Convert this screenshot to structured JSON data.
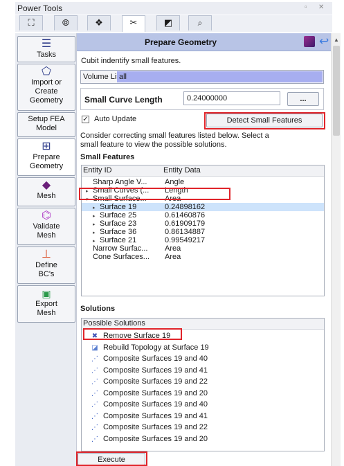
{
  "window": {
    "title": "Power Tools",
    "ctrl_float": "▫",
    "ctrl_close": "✕"
  },
  "top_tabs": [
    {
      "icon": "mesh-tool-icon",
      "glyph": "⛶"
    },
    {
      "icon": "geometry-tool-icon",
      "glyph": "⦾"
    },
    {
      "icon": "cluster-tool-icon",
      "glyph": "❖"
    },
    {
      "icon": "prepare-geometry-tab-icon",
      "glyph": "✂"
    },
    {
      "icon": "image-tab-icon",
      "glyph": "◩"
    },
    {
      "icon": "search-icon",
      "glyph": "🔍"
    }
  ],
  "sidebar": {
    "items": [
      {
        "label": "Tasks",
        "icon": "list-icon",
        "glyph": "☰"
      },
      {
        "label": "Import or Create Geometry",
        "icon": "geometry-import-icon",
        "glyph": "⬠"
      },
      {
        "label": "Setup FEA Model",
        "icon": "",
        "glyph": ""
      },
      {
        "label": "Prepare Geometry",
        "icon": "prepare-geometry-icon",
        "glyph": "⊞"
      },
      {
        "label": "Mesh",
        "icon": "mesh-cube-icon",
        "glyph": "◆"
      },
      {
        "label": "Validate Mesh",
        "icon": "validate-mesh-icon",
        "glyph": "⌬"
      },
      {
        "label": "Define BC's",
        "icon": "define-bc-icon",
        "glyph": "⊥"
      },
      {
        "label": "Export Mesh",
        "icon": "save-icon",
        "glyph": "💾"
      }
    ]
  },
  "panel": {
    "title": "Prepare Geometry",
    "intro_text": "Cubit indentify small features.",
    "volume_list_label": "Volume List",
    "volume_list_value": "all",
    "small_curve_label": "Small Curve Length",
    "small_curve_value": "0.24000000",
    "browse_label": "...",
    "auto_update_label": "Auto Update",
    "auto_update_checked": true,
    "check_glyph": "✓",
    "detect_button_label": "Detect Small Features",
    "instruction_text_1": "Consider correcting small features listed below. Select a",
    "instruction_text_2": "small feature to view the possible solutions.",
    "small_features_heading": "Small Features",
    "tree_headers": {
      "entity_id": "Entity ID",
      "entity_data": "Entity Data"
    },
    "tree_rows": [
      {
        "id": "Sharp Angle V...",
        "data": "Angle",
        "arrow": "",
        "indent": 1,
        "selected": false
      },
      {
        "id": "Small Curves (...",
        "data": "Length",
        "arrow": "▸",
        "indent": 1,
        "selected": false
      },
      {
        "id": "Small Surface...",
        "data": "Area",
        "arrow": "▾",
        "indent": 1,
        "selected": false
      },
      {
        "id": "Surface 19",
        "data": "0.24898162",
        "arrow": "▸",
        "indent": 2,
        "selected": true
      },
      {
        "id": "Surface 25",
        "data": "0.61460876",
        "arrow": "▸",
        "indent": 2,
        "selected": false
      },
      {
        "id": "Surface 23",
        "data": "0.61909179",
        "arrow": "▸",
        "indent": 2,
        "selected": false
      },
      {
        "id": "Surface 36",
        "data": "0.86134887",
        "arrow": "▸",
        "indent": 2,
        "selected": false
      },
      {
        "id": "Surface 21",
        "data": "0.99549217",
        "arrow": "▸",
        "indent": 2,
        "selected": false
      },
      {
        "id": "Narrow Surfac...",
        "data": "Area",
        "arrow": "",
        "indent": 1,
        "selected": false
      },
      {
        "id": "Cone Surfaces...",
        "data": "Area",
        "arrow": "",
        "indent": 1,
        "selected": false
      }
    ],
    "solutions_heading": "Solutions",
    "possible_solutions_header": "Possible Solutions",
    "solutions": [
      {
        "label": "Remove Surface 19",
        "icon": "remove-surface-icon",
        "glyph": "✖"
      },
      {
        "label": "Rebuild Topology at Surface 19",
        "icon": "rebuild-topology-icon",
        "glyph": "◪"
      },
      {
        "label": "Composite Surfaces 19 and 40",
        "icon": "composite-surfaces-icon",
        "glyph": "⋰"
      },
      {
        "label": "Composite Surfaces 19 and 41",
        "icon": "composite-surfaces-icon",
        "glyph": "⋰"
      },
      {
        "label": "Composite Surfaces 19 and 22",
        "icon": "composite-surfaces-icon",
        "glyph": "⋰"
      },
      {
        "label": "Composite Surfaces 19 and 20",
        "icon": "composite-surfaces-icon",
        "glyph": "⋰"
      },
      {
        "label": "Composite Surfaces 19 and 40",
        "icon": "composite-surfaces-icon",
        "glyph": "⋰"
      },
      {
        "label": "Composite Surfaces 19 and 41",
        "icon": "composite-surfaces-icon",
        "glyph": "⋰"
      },
      {
        "label": "Composite Surfaces 19 and 22",
        "icon": "composite-surfaces-icon",
        "glyph": "⋰"
      },
      {
        "label": "Composite Surfaces 19 and 20",
        "icon": "composite-surfaces-icon",
        "glyph": "⋰"
      }
    ],
    "execute_label": "Execute"
  },
  "colors": {
    "header_bg": "#b8c4e6",
    "volume_field_bg": "#a7aef0",
    "highlight_red": "#e0242a",
    "selection_bg": "#cde3fb"
  }
}
